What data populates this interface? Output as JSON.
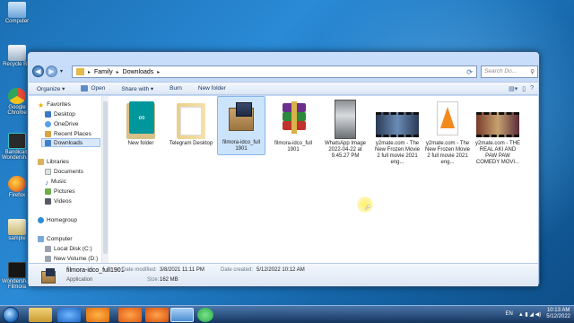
{
  "desktop": {
    "icons": [
      {
        "label": "Computer",
        "color": "#9cc7ee"
      },
      {
        "label": "Recycle Bin",
        "color": "#c8d8e8"
      },
      {
        "label": "Google Chrome",
        "color": "#e84b3c"
      },
      {
        "label": "Bandicam Wondershare",
        "color": "#3ec1c7"
      },
      {
        "label": "Firefox",
        "color": "#f08a24"
      },
      {
        "label": "sample",
        "color": "#e0d8b0"
      },
      {
        "label": "Wondershare Filmora",
        "color": "#1a1a1a"
      }
    ]
  },
  "explorer": {
    "breadcrumb": [
      "Family",
      "Downloads"
    ],
    "search_placeholder": "Search Do...",
    "toolbar": {
      "organize": "Organize ▾",
      "open": "Open",
      "share_with": "Share with ▾",
      "burn": "Burn",
      "new_folder": "New folder"
    },
    "sidebar": {
      "favorites": "Favorites",
      "desktop": "Desktop",
      "onedrive": "OneDrive",
      "recent_places": "Recent Places",
      "downloads": "Downloads",
      "libraries": "Libraries",
      "documents": "Documents",
      "music": "Music",
      "pictures": "Pictures",
      "videos": "Videos",
      "homegroup": "Homegroup",
      "computer": "Computer",
      "local_disk": "Local Disk (C:)",
      "new_volume": "New Volume (D:)"
    },
    "files": [
      {
        "name": "New folder",
        "icon": "arduino-folder-icon"
      },
      {
        "name": "Telegram Desktop",
        "icon": "folder-icon"
      },
      {
        "name": "filmora-idco_full 1901",
        "icon": "installer-box-icon",
        "selected": true
      },
      {
        "name": "filmora-idco_full 1901",
        "icon": "winrar-archive-icon"
      },
      {
        "name": "WhatsApp Image 2022-04-22 at 9.45.27 PM",
        "icon": "image-thumbnail-icon"
      },
      {
        "name": "y2mate.com - The New Frozen Movie 2 full movie 2021 eng...",
        "icon": "video-thumbnail-icon"
      },
      {
        "name": "y2mate.com - The New Frozen Movie 2 full movie 2021 eng...",
        "icon": "vlc-cone-icon"
      },
      {
        "name": "y2mate.com - THE REAL AKI AND PAW PAW COMEDY MOVI...",
        "icon": "video-thumbnail-icon"
      }
    ],
    "details": {
      "name": "filmora-idco_full1901",
      "type": "Application",
      "date_modified_label": "Date modified:",
      "date_modified": "3/8/2021 11:11 PM",
      "size_label": "Size:",
      "size": "162 MB",
      "date_created_label": "Date created:",
      "date_created": "5/12/2022 10:12 AM"
    }
  },
  "taskbar": {
    "lang": "EN",
    "time": "10:13 AM",
    "date": "5/12/2022"
  }
}
